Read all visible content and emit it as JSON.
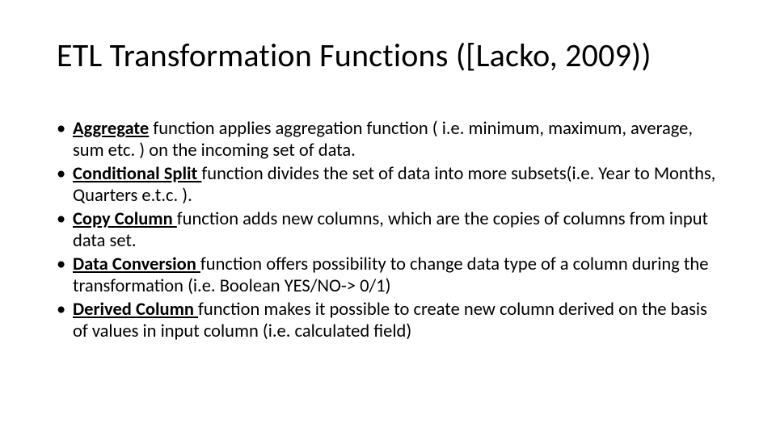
{
  "title": "ETL Transformation Functions ([Lacko, 2009))",
  "bullets": [
    {
      "name": "Aggregate",
      "trail": " function applies aggregation function ( i.e. minimum, maximum, average, sum etc. ) on the incoming set of data."
    },
    {
      "name": "Conditional Split ",
      "trail": "function divides the set of data into more subsets(i.e. Year to Months, Quarters e.t.c. )."
    },
    {
      "name": "Copy Column ",
      "trail": "function adds new columns, which are the copies of columns from input data set."
    },
    {
      "name": "Data Conversion ",
      "trail": "function offers possibility to change data type of a column during the transformation (i.e. Boolean YES/NO-> 0/1)"
    },
    {
      "name": "Derived Column ",
      "trail": "function makes it possible to create new column derived on the basis of values in input column (i.e. calculated field)"
    }
  ]
}
